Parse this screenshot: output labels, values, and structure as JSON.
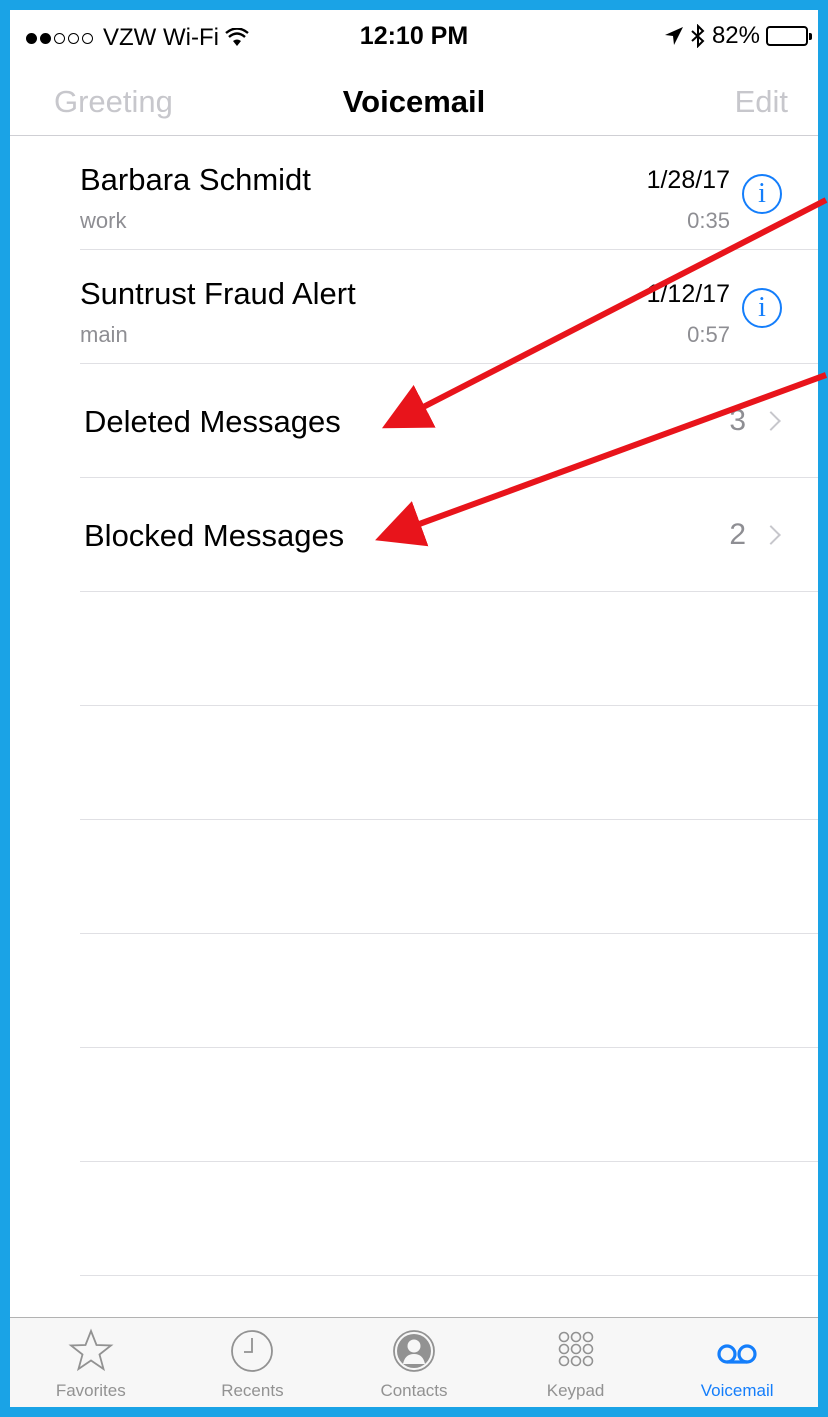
{
  "status_bar": {
    "carrier": "VZW Wi-Fi",
    "time": "12:10 PM",
    "battery": "82%",
    "battery_level": 0.82,
    "signal_bars_filled": 2,
    "signal_bars_total": 5
  },
  "nav": {
    "left": "Greeting",
    "title": "Voicemail",
    "right": "Edit"
  },
  "voicemails": [
    {
      "name": "Barbara Schmidt",
      "label": "work",
      "date": "1/28/17",
      "duration": "0:35"
    },
    {
      "name": "Suntrust Fraud Alert",
      "label": "main",
      "date": "1/12/17",
      "duration": "0:57"
    }
  ],
  "folders": [
    {
      "label": "Deleted Messages",
      "count": "3"
    },
    {
      "label": "Blocked Messages",
      "count": "2"
    }
  ],
  "info_glyph": "i",
  "tabs": [
    {
      "label": "Favorites",
      "icon": "star-icon"
    },
    {
      "label": "Recents",
      "icon": "clock-icon"
    },
    {
      "label": "Contacts",
      "icon": "contact-icon"
    },
    {
      "label": "Keypad",
      "icon": "keypad-icon"
    },
    {
      "label": "Voicemail",
      "icon": "voicemail-icon"
    }
  ],
  "colors": {
    "accent": "#147efb",
    "frame": "#1aa3e6",
    "annotation_arrow": "#e8141b",
    "inactive": "#929292"
  }
}
